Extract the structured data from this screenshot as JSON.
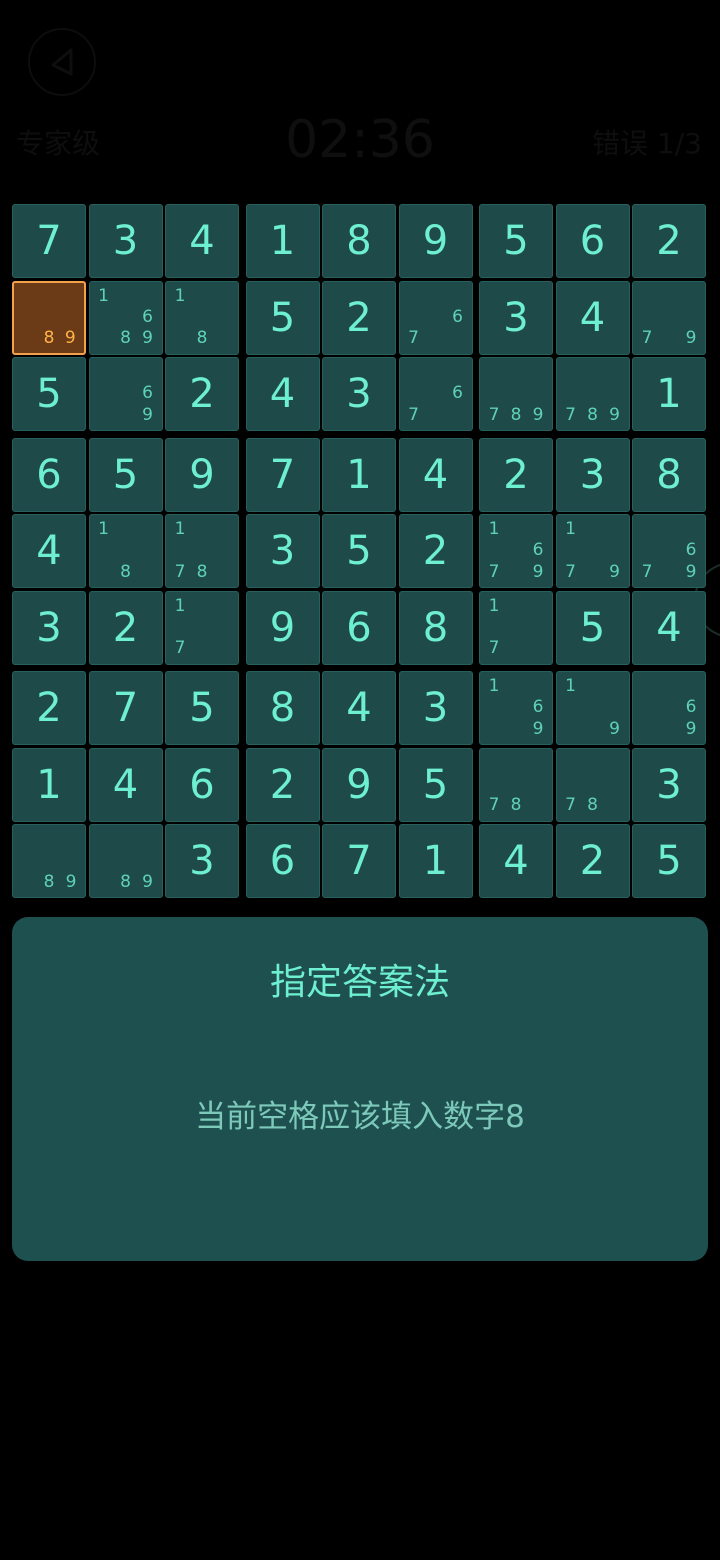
{
  "header": {
    "difficulty": "专家级",
    "timer": "02:36",
    "mistakes": "错误 1/3"
  },
  "icons": {
    "back": "back-triangle-icon",
    "side": "side-handle-icon"
  },
  "colors": {
    "background": "#000000",
    "cell": "#1e4b4a",
    "selected_cell": "#6b3a17",
    "selected_border": "#f3a14a",
    "digit": "#6eefd0",
    "panel": "#1e5050"
  },
  "board": {
    "selected": [
      1,
      0
    ],
    "cells": [
      [
        {
          "v": "7"
        },
        {
          "v": "3"
        },
        {
          "v": "4"
        },
        {
          "v": "1"
        },
        {
          "v": "8"
        },
        {
          "v": "9"
        },
        {
          "v": "5"
        },
        {
          "v": "6"
        },
        {
          "v": "2"
        }
      ],
      [
        {
          "n": [
            8,
            9
          ]
        },
        {
          "n": [
            1,
            6,
            8,
            9
          ]
        },
        {
          "n": [
            1,
            8
          ]
        },
        {
          "v": "5"
        },
        {
          "v": "2"
        },
        {
          "n": [
            6,
            7
          ]
        },
        {
          "v": "3"
        },
        {
          "v": "4"
        },
        {
          "n": [
            7,
            9
          ]
        }
      ],
      [
        {
          "v": "5"
        },
        {
          "n": [
            6,
            9
          ]
        },
        {
          "v": "2"
        },
        {
          "v": "4"
        },
        {
          "v": "3"
        },
        {
          "n": [
            6,
            7
          ]
        },
        {
          "n": [
            7,
            8,
            9
          ]
        },
        {
          "n": [
            7,
            8,
            9
          ]
        },
        {
          "v": "1"
        }
      ],
      [
        {
          "v": "6"
        },
        {
          "v": "5"
        },
        {
          "v": "9"
        },
        {
          "v": "7"
        },
        {
          "v": "1"
        },
        {
          "v": "4"
        },
        {
          "v": "2"
        },
        {
          "v": "3"
        },
        {
          "v": "8"
        }
      ],
      [
        {
          "v": "4"
        },
        {
          "n": [
            1,
            8
          ]
        },
        {
          "n": [
            1,
            7,
            8
          ]
        },
        {
          "v": "3"
        },
        {
          "v": "5"
        },
        {
          "v": "2"
        },
        {
          "n": [
            1,
            6,
            7,
            9
          ]
        },
        {
          "n": [
            1,
            7,
            9
          ]
        },
        {
          "n": [
            6,
            7,
            9
          ]
        }
      ],
      [
        {
          "v": "3"
        },
        {
          "v": "2"
        },
        {
          "n": [
            1,
            7
          ]
        },
        {
          "v": "9"
        },
        {
          "v": "6"
        },
        {
          "v": "8"
        },
        {
          "n": [
            1,
            7
          ]
        },
        {
          "v": "5"
        },
        {
          "v": "4"
        }
      ],
      [
        {
          "v": "2"
        },
        {
          "v": "7"
        },
        {
          "v": "5"
        },
        {
          "v": "8"
        },
        {
          "v": "4"
        },
        {
          "v": "3"
        },
        {
          "n": [
            1,
            6,
            9
          ]
        },
        {
          "n": [
            1,
            9
          ]
        },
        {
          "n": [
            6,
            9
          ]
        }
      ],
      [
        {
          "v": "1"
        },
        {
          "v": "4"
        },
        {
          "v": "6"
        },
        {
          "v": "2"
        },
        {
          "v": "9"
        },
        {
          "v": "5"
        },
        {
          "n": [
            7,
            8
          ]
        },
        {
          "n": [
            7,
            8
          ]
        },
        {
          "v": "3"
        }
      ],
      [
        {
          "n": [
            8,
            9
          ]
        },
        {
          "n": [
            8,
            9
          ]
        },
        {
          "v": "3"
        },
        {
          "v": "6"
        },
        {
          "v": "7"
        },
        {
          "v": "1"
        },
        {
          "v": "4"
        },
        {
          "v": "2"
        },
        {
          "v": "5"
        }
      ]
    ]
  },
  "hint_panel": {
    "title": "指定答案法",
    "message": "当前空格应该填入数字8"
  }
}
